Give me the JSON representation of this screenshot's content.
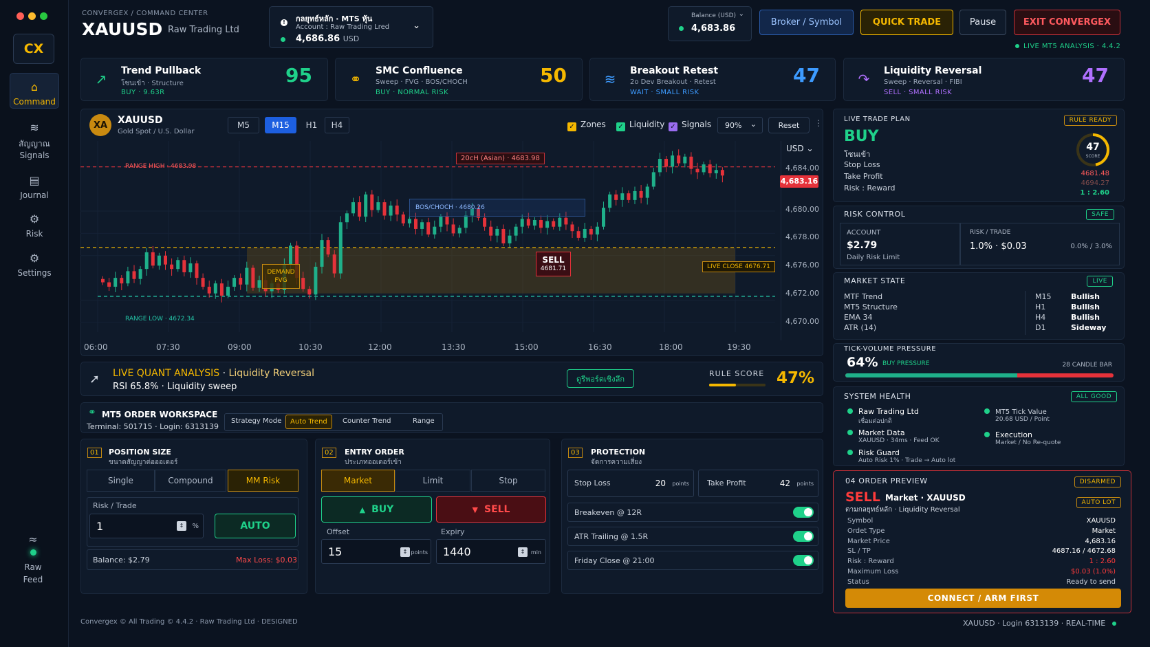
{
  "sidebar": {
    "logo": "CX",
    "items": [
      {
        "label": "Command",
        "icon": "home-icon"
      },
      {
        "label": "สัญญาณ",
        "sub": "Signals",
        "icon": "signal-icon"
      },
      {
        "label": "Journal",
        "icon": "journal-icon"
      },
      {
        "label": "Risk",
        "icon": "risk-icon"
      },
      {
        "label": "Settings",
        "icon": "gear-icon"
      }
    ],
    "feed_label": "Raw",
    "feed_sub": "Feed"
  },
  "header": {
    "breadcrumb": "CONVERGEX / COMMAND CENTER",
    "symbol": "XAUUSD",
    "broker": "Raw Trading Ltd",
    "account_line1": "กลยุทธ์หลัก · MTS หุ้น",
    "account_line2": "Account : Raw Trading Lred",
    "account_balance": "4,686.86",
    "account_currency": "USD",
    "balance_label": "Balance (USD)",
    "balance_value": "4,683.86",
    "btn_broker": "Broker / Symbol",
    "btn_quick": "QUICK TRADE",
    "btn_pause": "Pause",
    "btn_exit": "EXIT CONVERGEX",
    "live_status": "LIVE MT5 ANALYSIS · 4.4.2"
  },
  "strategies": [
    {
      "title": "Trend Pullback",
      "sub": "โซนเข้า · Structure",
      "action": "BUY · 9.63R",
      "score": "95",
      "icon": "arrow-up-right-icon"
    },
    {
      "title": "SMC Confluence",
      "sub": "Sweep · FVG · BOS/CHOCH",
      "action": "BUY · NORMAL RISK",
      "score": "50",
      "icon": "link-icon"
    },
    {
      "title": "Breakout Retest",
      "sub": "2o Dev Breakout · Retest",
      "action": "WAIT · SMALL RISK",
      "score": "47",
      "icon": "waves-icon"
    },
    {
      "title": "Liquidity Reversal",
      "sub": "Sweep · Reversal · FIBI",
      "action": "SELL · SMALL RISK",
      "score": "47",
      "icon": "reversal-icon"
    }
  ],
  "chart": {
    "avatar": "XA",
    "symbol": "XAUUSD",
    "desc": "Gold Spot / U.S. Dollar",
    "timeframes": [
      "M5",
      "M15",
      "H1",
      "H4"
    ],
    "active_tf": "M15",
    "toggles": [
      "Zones",
      "Liquidity",
      "Signals"
    ],
    "zoom": "90%",
    "reset": "Reset",
    "currency": "USD",
    "price_tag": "4,683.16",
    "annotations": {
      "range_high": "RANGE HIGH · 4683.98",
      "range_low": "RANGE LOW · 4672.34",
      "asian": "20cH (Asian) · 4683.98",
      "bos": "BOS/CHOCH · 4680.26",
      "demand": "DEMAND",
      "fvg": "FVG",
      "sell": "SELL",
      "sell_price": "4681.71",
      "live_close": "LIVE CLOSE 4676.71"
    }
  },
  "chart_data": {
    "type": "candlestick",
    "x_ticks": [
      "06:00",
      "07:30",
      "09:00",
      "10:30",
      "12:00",
      "13:30",
      "15:00",
      "16:30",
      "18:00",
      "19:30"
    ],
    "y_ticks": [
      "4,684.00",
      "4,680.00",
      "4,678.00",
      "4,676.00",
      "4,672.00",
      "4,670.00"
    ],
    "ylim": [
      4669,
      4686
    ],
    "levels": {
      "range_high": 4683.98,
      "range_low": 4672.34,
      "live_close": 4676.71
    },
    "close_path": [
      4673.6,
      4673.2,
      4674.0,
      4673.5,
      4674.6,
      4673.9,
      4674.8,
      4676.3,
      4675.1,
      4676.0,
      4675.2,
      4674.8,
      4675.6,
      4674.5,
      4675.3,
      4674.0,
      4673.2,
      4672.6,
      4673.5,
      4672.4,
      4673.2,
      4674.0,
      4673.4,
      4674.9,
      4673.1,
      4673.8,
      4672.8,
      4673.5,
      4672.9,
      4675.2,
      4676.9,
      4674.0,
      4673.0,
      4672.5,
      4675.0,
      4677.4,
      4676.1,
      4674.4,
      4679.0,
      4679.8,
      4680.8,
      4679.5,
      4681.5,
      4680.1,
      4680.8,
      4679.6,
      4680.5,
      4679.7,
      4678.9,
      4679.3,
      4678.4,
      4679.0,
      4677.9,
      4678.6,
      4679.5,
      4678.8,
      4678.0,
      4678.5,
      4679.6,
      4680.2,
      4679.4,
      4678.6,
      4677.8,
      4678.4,
      4677.1,
      4677.8,
      4678.6,
      4679.3,
      4678.7,
      4679.2,
      4678.5,
      4679.1,
      4678.6,
      4679.4,
      4678.8,
      4678.2,
      4677.6,
      4678.4,
      4677.9,
      4678.6,
      4680.3,
      4681.5,
      4681.0,
      4681.6,
      4681.0,
      4681.8,
      4681.2,
      4682.2,
      4683.5,
      4684.7,
      4684.0,
      4685.0,
      4684.3,
      4684.9,
      4683.8,
      4683.5,
      4684.2,
      4683.4,
      4683.7,
      4683.2
    ]
  },
  "analysis": {
    "title": "LIVE QUANT ANALYSIS",
    "strategy": "Liquidity Reversal",
    "sub": "RSI 65.8% · Liquidity sweep",
    "btn": "ดูรีพอร์ตเชิงลึก",
    "score_label": "RULE SCORE",
    "score": "47%",
    "score_frac": 0.47
  },
  "workspace": {
    "title": "MT5 ORDER WORKSPACE",
    "terminal": "Terminal: 501715 · Login: 6313139",
    "modes": [
      "Strategy Mode",
      "Auto Trend",
      "Counter Trend",
      "Range"
    ],
    "active_mode": "Auto Trend"
  },
  "position": {
    "num": "01",
    "title": "POSITION SIZE",
    "sub": "ขนาดสัญญาต่อออเดอร์",
    "tabs": [
      "Single",
      "Compound",
      "MM Risk"
    ],
    "risk_label": "Risk / Trade",
    "risk_value": "1",
    "unit": "%",
    "auto": "AUTO",
    "balance": "Balance: $2.79",
    "max_loss": "Max Loss: $0.03"
  },
  "entry": {
    "num": "02",
    "title": "ENTRY ORDER",
    "sub": "ประเภทออเดอร์เข้า",
    "tabs": [
      "Market",
      "Limit",
      "Stop"
    ],
    "buy": "BUY",
    "sell": "SELL",
    "offset_label": "Offset",
    "offset": "15",
    "offset_unit": "points",
    "expiry_label": "Expiry",
    "expiry": "1440",
    "expiry_unit": "min"
  },
  "protection": {
    "num": "03",
    "title": "PROTECTION",
    "sub": "จัดการความเสี่ยง",
    "sl_label": "Stop Loss",
    "sl": "20",
    "tp_label": "Take Profit",
    "tp": "42",
    "unit": "points",
    "toggles": [
      "Breakeven @ 12R",
      "ATR Trailing @ 1.5R",
      "Friday Close @ 21:00"
    ]
  },
  "trade_plan": {
    "title": "LIVE TRADE PLAN",
    "badge": "RULE READY",
    "side": "BUY",
    "zone": "โซนเข้า",
    "rows": [
      "Stop Loss",
      "Take Profit",
      "Risk : Reward"
    ],
    "score": "47",
    "score_label": "SCORE",
    "score_frac": 0.47,
    "sl": "4681.48",
    "tp": "4694.27",
    "rr": "1 : 2.60"
  },
  "risk": {
    "title": "RISK CONTROL",
    "badge": "SAFE",
    "account_label": "ACCOUNT",
    "account": "$2.79",
    "daily": "Daily Risk Limit",
    "trade_label": "RISK / TRADE",
    "trade": "1.0% · $0.03",
    "range": "0.0% / 3.0%"
  },
  "market": {
    "title": "MARKET STATE",
    "badge": "LIVE",
    "left": [
      "MTF Trend",
      "MT5 Structure",
      "EMA 34",
      "ATR (14)"
    ],
    "tfs": [
      "M15",
      "H1",
      "H4",
      "D1"
    ],
    "vals": [
      "Bullish",
      "Bullish",
      "Bullish",
      "Sideway"
    ]
  },
  "pressure": {
    "title": "TICK-VOLUME PRESSURE",
    "value": "64%",
    "label": "BUY PRESSURE",
    "candles": "28 CANDLE BAR",
    "frac": 0.64
  },
  "health": {
    "title": "SYSTEM HEALTH",
    "badge": "ALL GOOD",
    "items": [
      {
        "t": "Raw Trading Ltd",
        "s": "เชื่อมต่อปกติ"
      },
      {
        "t": "Market Data",
        "s": "XAUUSD · 34ms · Feed OK"
      },
      {
        "t": "Risk Guard",
        "s": "Auto Risk 1% · Trade → Auto lot"
      },
      {
        "t": "MT5 Tick Value",
        "s": "20.68 USD / Point"
      },
      {
        "t": "Execution",
        "s": "Market / No Re-quote"
      }
    ]
  },
  "preview": {
    "title": "04 ORDER PREVIEW",
    "badge": "DISARMED",
    "badge2": "AUTO LOT",
    "side": "SELL",
    "type": "Market · XAUUSD",
    "sub": "ตามกลยุทธ์หลัก · Liquidity Reversal",
    "rows": [
      {
        "k": "Symbol",
        "v": "XAUUSD"
      },
      {
        "k": "Ordet Type",
        "v": "Market"
      },
      {
        "k": "Market Price",
        "v": "4,683.16"
      },
      {
        "k": "SL / TP",
        "v": "4687.16 / 4672.68"
      },
      {
        "k": "Risk : Reward",
        "v": "1 : 2.60"
      },
      {
        "k": "Maximum Loss",
        "v": "$0.03 (1.0%)"
      },
      {
        "k": "Status",
        "v": "Ready to send"
      }
    ],
    "connect": "CONNECT / ARM FIRST"
  },
  "footer": {
    "left": "Convergex © All Trading © 4.4.2 · Raw Trading Ltd · DESIGNED",
    "right": "XAUUSD · Login 6313139 · REAL-TIME"
  }
}
